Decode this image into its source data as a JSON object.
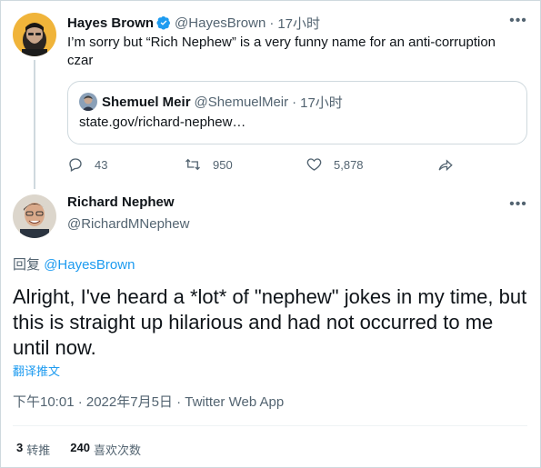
{
  "parent_tweet": {
    "author_name": "Hayes Brown",
    "author_handle": "@HayesBrown",
    "separator": "·",
    "time": "17小时",
    "text": "I’m sorry but “Rich Nephew” is a very funny name for an anti-corruption czar",
    "more_glyph": "•••",
    "quote": {
      "author_name": "Shemuel Meir",
      "author_handle": "@ShemuelMeir",
      "separator": "·",
      "time": "17小时",
      "text": "state.gov/richard-nephew…"
    },
    "actions": {
      "replies": "43",
      "retweets": "950",
      "likes": "5,878"
    }
  },
  "main_tweet": {
    "author_name": "Richard Nephew",
    "author_handle": "@RichardMNephew",
    "more_glyph": "•••",
    "reply_prefix": "回复",
    "reply_to": "@HayesBrown",
    "text": "Alright, I've heard a *lot* of \"nephew\" jokes in my time, but this is straight up hilarious and had not occurred to me until now.",
    "translate_label": "翻译推文",
    "timestamp": "下午10:01 · 2022年7月5日 · Twitter Web App",
    "stats": {
      "retweets_count": "3",
      "retweets_label": "转推",
      "likes_count": "240",
      "likes_label": "喜欢次数"
    }
  },
  "colors": {
    "accent": "#1d9bf0",
    "muted_text": "#536471",
    "border": "#cfd9de"
  }
}
